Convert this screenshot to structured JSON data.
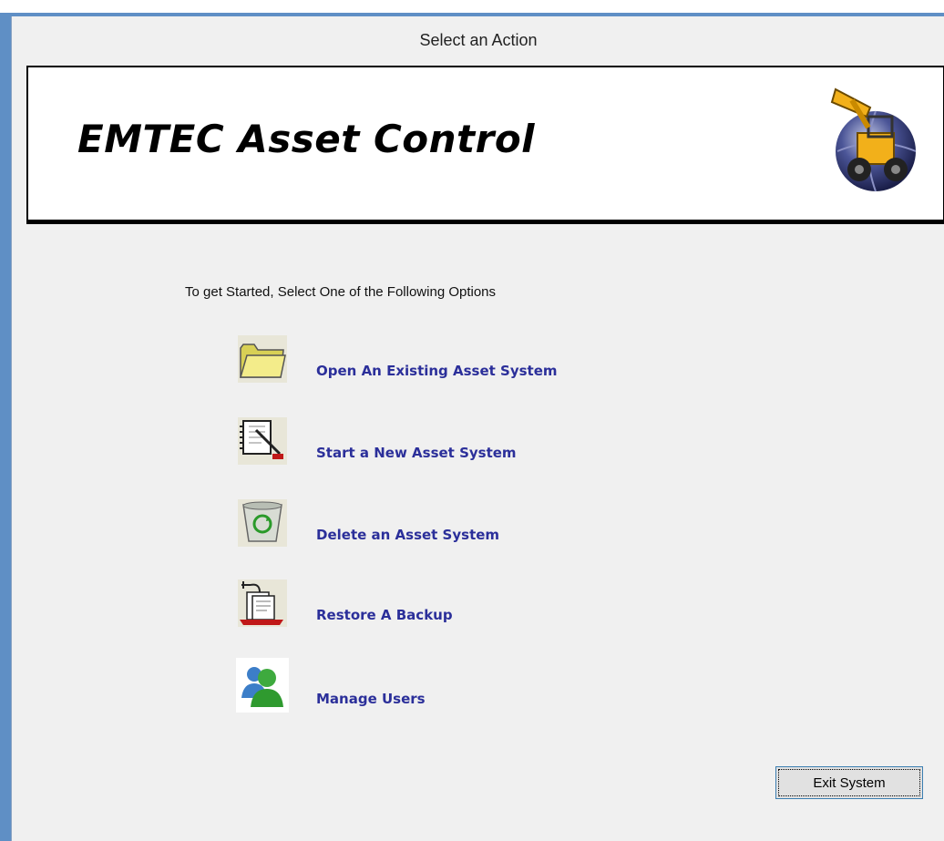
{
  "window": {
    "title": "Select an Action"
  },
  "banner": {
    "title": "EMTEC Asset Control",
    "logo_icon": "loader-on-globe-icon"
  },
  "prompt": "To get Started, Select One of the Following Options",
  "options": [
    {
      "label": "Open An Existing Asset System",
      "icon": "folder-icon"
    },
    {
      "label": "Start a New Asset System",
      "icon": "new-document-icon"
    },
    {
      "label": "Delete an Asset System",
      "icon": "recycle-bin-icon"
    },
    {
      "label": "Restore A Backup",
      "icon": "backup-restore-icon"
    },
    {
      "label": "Manage Users",
      "icon": "users-icon"
    }
  ],
  "exit_button": {
    "label": "Exit System"
  },
  "colors": {
    "link": "#2b2f9a",
    "frame": "#5f8fc5",
    "background": "#f0f0f0"
  }
}
